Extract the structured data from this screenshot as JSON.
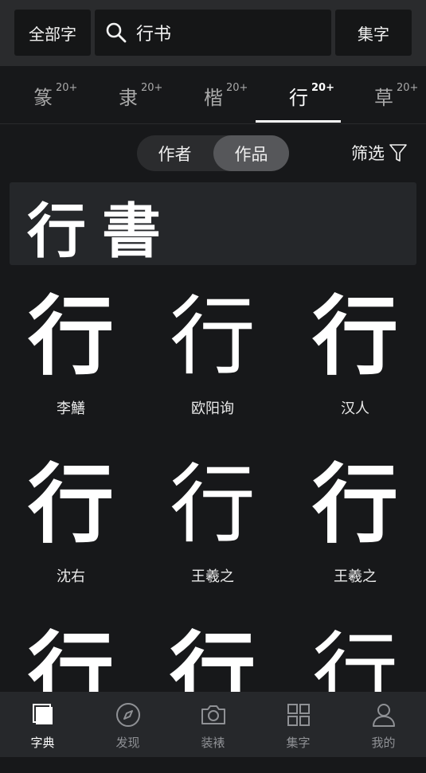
{
  "header": {
    "all_chars_label": "全部字",
    "search_value": "行书",
    "collect_label": "集字"
  },
  "script_tabs": [
    {
      "label": "篆",
      "count": "20+",
      "active": false
    },
    {
      "label": "隶",
      "count": "20+",
      "active": false
    },
    {
      "label": "楷",
      "count": "20+",
      "active": false
    },
    {
      "label": "行",
      "count": "20+",
      "active": true
    },
    {
      "label": "草",
      "count": "20+",
      "active": false
    }
  ],
  "segment": {
    "left_label": "作者",
    "right_label": "作品",
    "selected": "作品"
  },
  "filter_label": "筛选",
  "banner_text": "行書",
  "grid": [
    {
      "char": "行",
      "author": "李鱔"
    },
    {
      "char": "行",
      "author": "欧阳询"
    },
    {
      "char": "行",
      "author": "汉人"
    },
    {
      "char": "行",
      "author": "沈右"
    },
    {
      "char": "行",
      "author": "王羲之"
    },
    {
      "char": "行",
      "author": "王羲之"
    },
    {
      "char": "行",
      "author": ""
    },
    {
      "char": "行",
      "author": ""
    },
    {
      "char": "行",
      "author": ""
    }
  ],
  "bottom_nav": [
    {
      "label": "字典",
      "icon": "dictionary-icon",
      "active": true
    },
    {
      "label": "发现",
      "icon": "compass-icon",
      "active": false
    },
    {
      "label": "装裱",
      "icon": "camera-icon",
      "active": false
    },
    {
      "label": "集字",
      "icon": "grid-icon",
      "active": false
    },
    {
      "label": "我的",
      "icon": "user-icon",
      "active": false
    }
  ],
  "colors": {
    "background": "#17181a",
    "topbar": "#2a2b2d",
    "segment_selected": "#56575a"
  }
}
